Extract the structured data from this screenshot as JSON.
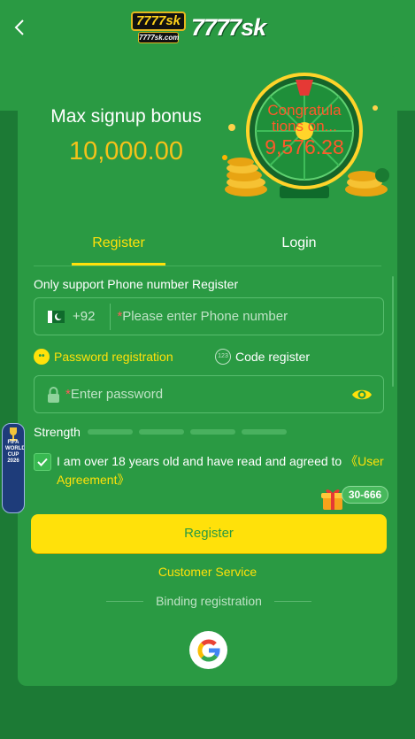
{
  "header": {
    "back_icon": "chevron-left-icon",
    "logo_badge_top": "7777sk",
    "logo_badge_bottom": "7777sk.com",
    "logo_text": "7777sk"
  },
  "promo": {
    "title": "Max signup bonus",
    "amount": "10,000.00",
    "wheel_line1": "Congratula",
    "wheel_line2": "tions on...",
    "wheel_amount": "9,576.28"
  },
  "tabs": [
    {
      "label": "Register",
      "active": true
    },
    {
      "label": "Login",
      "active": false
    }
  ],
  "form": {
    "section_label": "Only support Phone number Register",
    "country_code": "+92",
    "phone_placeholder": "Please enter Phone number",
    "required_mark": "*",
    "options": {
      "password_registration": "Password registration",
      "code_register": "Code register",
      "code_icon_text": "123"
    },
    "password_placeholder": "Enter password",
    "strength_label": "Strength",
    "agreement_text": "I am over 18 years old and have read and agreed to ",
    "agreement_link": "《User Agreement》",
    "agreement_checked": true,
    "register_button": "Register",
    "customer_service": "Customer Service",
    "binding_label": "Binding registration"
  },
  "floating": {
    "gift_badge": "30-666",
    "side_banner_text": "FIFA WORLD CUP 2026"
  },
  "colors": {
    "accent": "#ffe10a",
    "card_bg": "#2a9a43",
    "page_bg": "#1c7a35",
    "gold": "#f5c21a"
  }
}
